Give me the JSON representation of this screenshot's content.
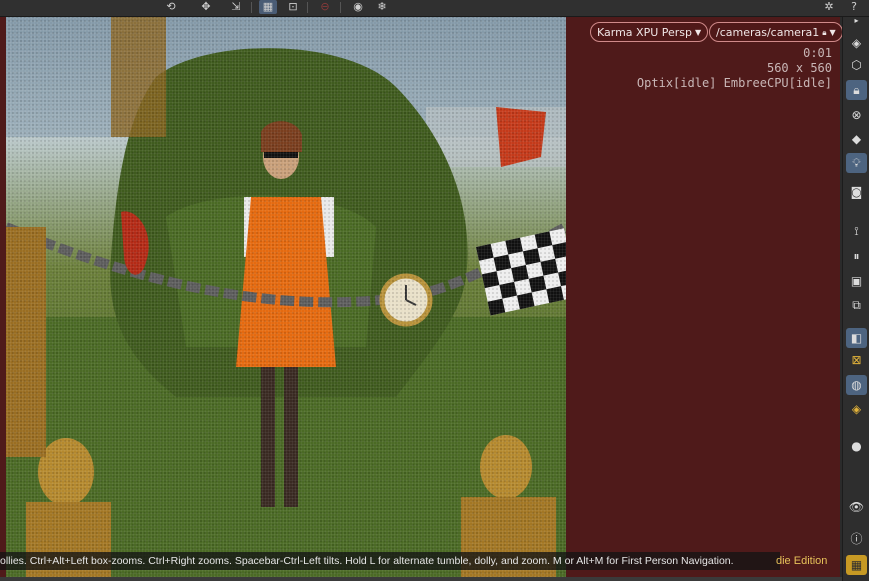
{
  "toolbar": {
    "icons": [
      "tumble-icon",
      "track-icon",
      "dolly-icon",
      "select-mode-icon",
      "zoom-region-icon",
      "stop-icon",
      "flipbook-icon",
      "snapshot-icon",
      "gear-icon",
      "help-icon"
    ]
  },
  "viewport": {
    "renderer_label": "Karma XPU  Persp",
    "camera_label": "/cameras/camera1",
    "time": "0:01",
    "resolution": "560 x 560",
    "engine_status": "Optix[idle] EmbreeCPU[idle]"
  },
  "status_text": "ollies. Ctrl+Alt+Left box-zooms. Ctrl+Right zooms. Spacebar-Ctrl-Left tilts. Hold L for alternate tumble, dolly, and zoom. M or Alt+M for First Person Navigation.",
  "edition_label": "die Edition",
  "right_toolbar": {
    "icons": [
      "display-options-icon",
      "ghost-icon",
      "lock-icon",
      "xray-icon",
      "headlight-icon",
      "light-bulb-icon",
      "camera-icon",
      "background-icon",
      "pause-icon",
      "render-settings-icon",
      "lop-icon",
      "material-icon",
      "guide-icon",
      "viewer-state-icon",
      "snapping-icon",
      "shading-ball-icon",
      "visibility-eye-icon",
      "info-icon",
      "layout-grid-icon"
    ]
  },
  "colors": {
    "viewport_bg": "#4f1a1a",
    "accent": "#4d6480",
    "edition_text": "#e7c25a"
  }
}
